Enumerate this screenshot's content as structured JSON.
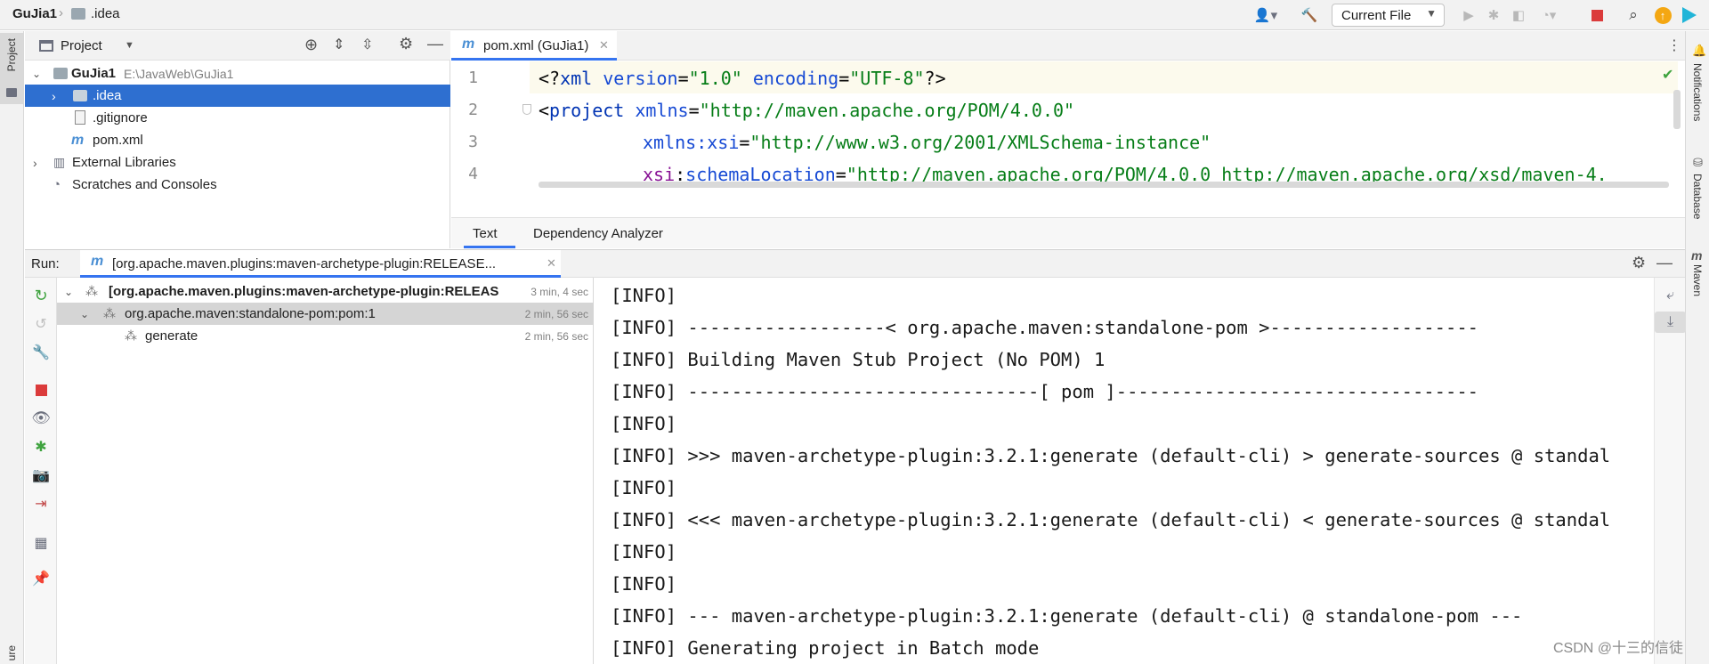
{
  "topbar": {
    "project": "GuJia1",
    "folder": ".idea",
    "run_config": "Current File"
  },
  "left_stripe": {
    "project_label": "Project",
    "bottom_label": "ure"
  },
  "right_stripe": {
    "notifications": "Notifications",
    "database": "Database",
    "maven": "Maven"
  },
  "project_panel": {
    "title": "Project",
    "tree": [
      {
        "label": "GuJia1",
        "path": "E:\\JavaWeb\\GuJia1"
      },
      {
        "label": ".idea"
      },
      {
        "label": ".gitignore"
      },
      {
        "label": "pom.xml"
      },
      {
        "label": "External Libraries"
      },
      {
        "label": "Scratches and Consoles"
      }
    ]
  },
  "editor": {
    "tab": "pom.xml (GuJia1)",
    "line_numbers": [
      "1",
      "2",
      "3",
      "4"
    ],
    "lines": {
      "l1": {
        "a": "<?",
        "b": "xml ",
        "c": "version",
        "d": "=",
        "e": "\"1.0\"",
        "f": " ",
        "g": "encoding",
        "h": "=",
        "i": "\"UTF-8\"",
        "j": "?>"
      },
      "l2": {
        "a": "<",
        "b": "project ",
        "c": "xmlns",
        "d": "=",
        "e": "\"http://maven.apache.org/POM/4.0.0\""
      },
      "l3": {
        "a": "xmlns:xsi",
        "b": "=",
        "c": "\"http://www.w3.org/2001/XMLSchema-instance\""
      },
      "l4": {
        "a": "xsi",
        "b": ":",
        "c": "schemaLocation",
        "d": "=",
        "e": "\"http://maven.apache.org/POM/4.0.0 http://maven.apache.org/xsd/maven-4."
      }
    },
    "bottom_tabs": [
      "Text",
      "Dependency Analyzer"
    ]
  },
  "run": {
    "label": "Run:",
    "tab": "[org.apache.maven.plugins:maven-archetype-plugin:RELEASE...",
    "tree": [
      {
        "label": "[org.apache.maven.plugins:maven-archetype-plugin:RELEAS",
        "time": "3 min, 4 sec"
      },
      {
        "label": "org.apache.maven:standalone-pom:pom:1",
        "time": "2 min, 56 sec"
      },
      {
        "label": "generate",
        "time": "2 min, 56 sec"
      }
    ],
    "console": [
      "[INFO]",
      "[INFO] ------------------< org.apache.maven:standalone-pom >-------------------",
      "[INFO] Building Maven Stub Project (No POM) 1",
      "[INFO] --------------------------------[ pom ]---------------------------------",
      "[INFO]",
      "[INFO] >>> maven-archetype-plugin:3.2.1:generate (default-cli) > generate-sources @ standal",
      "[INFO]",
      "[INFO] <<< maven-archetype-plugin:3.2.1:generate (default-cli) < generate-sources @ standal",
      "[INFO]",
      "[INFO]",
      "[INFO] --- maven-archetype-plugin:3.2.1:generate (default-cli) @ standalone-pom ---",
      "[INFO] Generating project in Batch mode"
    ]
  },
  "watermark": "CSDN @十三的信徒"
}
